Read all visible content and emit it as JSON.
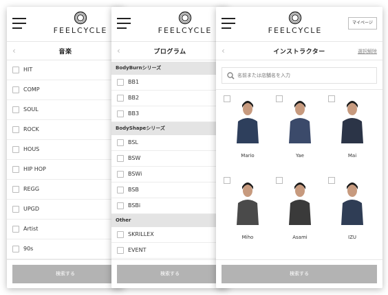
{
  "brand": {
    "name": "FEELCYCLE"
  },
  "screen_music": {
    "title": "音楽",
    "items": [
      "HIT",
      "COMP",
      "SOUL",
      "ROCK",
      "HOUS",
      "HIP HOP",
      "REGG",
      "UPGD",
      "Artist",
      "90s"
    ],
    "search_button": "検索する"
  },
  "screen_program": {
    "title": "プログラム",
    "sections": [
      {
        "name": "BodyBurnシリーズ",
        "items": [
          "BB1",
          "BB2",
          "BB3"
        ]
      },
      {
        "name": "BodyShapeシリーズ",
        "items": [
          "BSL",
          "BSW",
          "BSWi",
          "BSB",
          "BSBi"
        ]
      },
      {
        "name": "Other",
        "items": [
          "SKRILLEX",
          "EVENT"
        ]
      }
    ],
    "search_button": "検索する"
  },
  "screen_instructor": {
    "title": "インストラクター",
    "clear_label": "選択解除",
    "mypage_label": "マイページ",
    "search_placeholder": "名前または店舗名を入力",
    "instructors": [
      "Mario",
      "Yae",
      "Mai",
      "Miho",
      "Asami",
      "IZU"
    ],
    "search_button": "検索する"
  },
  "icons": {
    "back": "chevron-left-icon",
    "menu": "hamburger-menu-icon",
    "search": "search-icon",
    "logo": "feelcycle-logo-icon"
  },
  "colors": {
    "button_gray": "#b3b3b3",
    "section_gray": "#e4e4e4",
    "text": "#333333"
  }
}
